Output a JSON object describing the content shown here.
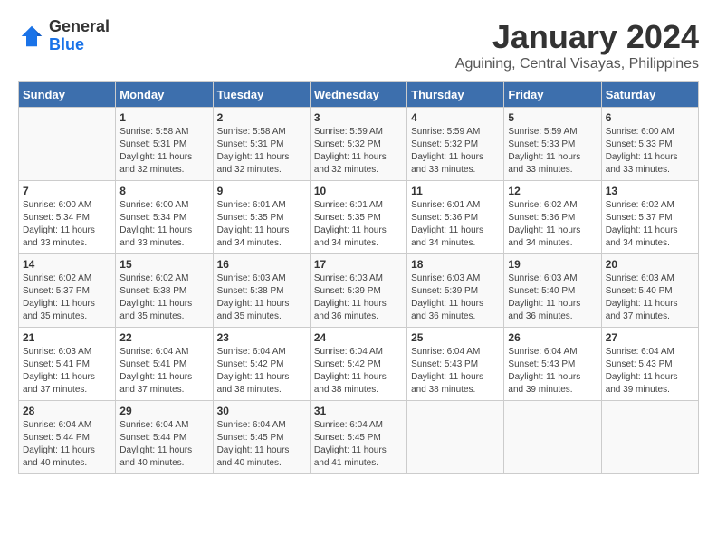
{
  "header": {
    "logo_line1": "General",
    "logo_line2": "Blue",
    "month": "January 2024",
    "location": "Aguining, Central Visayas, Philippines"
  },
  "days_of_week": [
    "Sunday",
    "Monday",
    "Tuesday",
    "Wednesday",
    "Thursday",
    "Friday",
    "Saturday"
  ],
  "weeks": [
    [
      {
        "day": "",
        "detail": ""
      },
      {
        "day": "1",
        "detail": "Sunrise: 5:58 AM\nSunset: 5:31 PM\nDaylight: 11 hours\nand 32 minutes."
      },
      {
        "day": "2",
        "detail": "Sunrise: 5:58 AM\nSunset: 5:31 PM\nDaylight: 11 hours\nand 32 minutes."
      },
      {
        "day": "3",
        "detail": "Sunrise: 5:59 AM\nSunset: 5:32 PM\nDaylight: 11 hours\nand 32 minutes."
      },
      {
        "day": "4",
        "detail": "Sunrise: 5:59 AM\nSunset: 5:32 PM\nDaylight: 11 hours\nand 33 minutes."
      },
      {
        "day": "5",
        "detail": "Sunrise: 5:59 AM\nSunset: 5:33 PM\nDaylight: 11 hours\nand 33 minutes."
      },
      {
        "day": "6",
        "detail": "Sunrise: 6:00 AM\nSunset: 5:33 PM\nDaylight: 11 hours\nand 33 minutes."
      }
    ],
    [
      {
        "day": "7",
        "detail": "Sunrise: 6:00 AM\nSunset: 5:34 PM\nDaylight: 11 hours\nand 33 minutes."
      },
      {
        "day": "8",
        "detail": "Sunrise: 6:00 AM\nSunset: 5:34 PM\nDaylight: 11 hours\nand 33 minutes."
      },
      {
        "day": "9",
        "detail": "Sunrise: 6:01 AM\nSunset: 5:35 PM\nDaylight: 11 hours\nand 34 minutes."
      },
      {
        "day": "10",
        "detail": "Sunrise: 6:01 AM\nSunset: 5:35 PM\nDaylight: 11 hours\nand 34 minutes."
      },
      {
        "day": "11",
        "detail": "Sunrise: 6:01 AM\nSunset: 5:36 PM\nDaylight: 11 hours\nand 34 minutes."
      },
      {
        "day": "12",
        "detail": "Sunrise: 6:02 AM\nSunset: 5:36 PM\nDaylight: 11 hours\nand 34 minutes."
      },
      {
        "day": "13",
        "detail": "Sunrise: 6:02 AM\nSunset: 5:37 PM\nDaylight: 11 hours\nand 34 minutes."
      }
    ],
    [
      {
        "day": "14",
        "detail": "Sunrise: 6:02 AM\nSunset: 5:37 PM\nDaylight: 11 hours\nand 35 minutes."
      },
      {
        "day": "15",
        "detail": "Sunrise: 6:02 AM\nSunset: 5:38 PM\nDaylight: 11 hours\nand 35 minutes."
      },
      {
        "day": "16",
        "detail": "Sunrise: 6:03 AM\nSunset: 5:38 PM\nDaylight: 11 hours\nand 35 minutes."
      },
      {
        "day": "17",
        "detail": "Sunrise: 6:03 AM\nSunset: 5:39 PM\nDaylight: 11 hours\nand 36 minutes."
      },
      {
        "day": "18",
        "detail": "Sunrise: 6:03 AM\nSunset: 5:39 PM\nDaylight: 11 hours\nand 36 minutes."
      },
      {
        "day": "19",
        "detail": "Sunrise: 6:03 AM\nSunset: 5:40 PM\nDaylight: 11 hours\nand 36 minutes."
      },
      {
        "day": "20",
        "detail": "Sunrise: 6:03 AM\nSunset: 5:40 PM\nDaylight: 11 hours\nand 37 minutes."
      }
    ],
    [
      {
        "day": "21",
        "detail": "Sunrise: 6:03 AM\nSunset: 5:41 PM\nDaylight: 11 hours\nand 37 minutes."
      },
      {
        "day": "22",
        "detail": "Sunrise: 6:04 AM\nSunset: 5:41 PM\nDaylight: 11 hours\nand 37 minutes."
      },
      {
        "day": "23",
        "detail": "Sunrise: 6:04 AM\nSunset: 5:42 PM\nDaylight: 11 hours\nand 38 minutes."
      },
      {
        "day": "24",
        "detail": "Sunrise: 6:04 AM\nSunset: 5:42 PM\nDaylight: 11 hours\nand 38 minutes."
      },
      {
        "day": "25",
        "detail": "Sunrise: 6:04 AM\nSunset: 5:43 PM\nDaylight: 11 hours\nand 38 minutes."
      },
      {
        "day": "26",
        "detail": "Sunrise: 6:04 AM\nSunset: 5:43 PM\nDaylight: 11 hours\nand 39 minutes."
      },
      {
        "day": "27",
        "detail": "Sunrise: 6:04 AM\nSunset: 5:43 PM\nDaylight: 11 hours\nand 39 minutes."
      }
    ],
    [
      {
        "day": "28",
        "detail": "Sunrise: 6:04 AM\nSunset: 5:44 PM\nDaylight: 11 hours\nand 40 minutes."
      },
      {
        "day": "29",
        "detail": "Sunrise: 6:04 AM\nSunset: 5:44 PM\nDaylight: 11 hours\nand 40 minutes."
      },
      {
        "day": "30",
        "detail": "Sunrise: 6:04 AM\nSunset: 5:45 PM\nDaylight: 11 hours\nand 40 minutes."
      },
      {
        "day": "31",
        "detail": "Sunrise: 6:04 AM\nSunset: 5:45 PM\nDaylight: 11 hours\nand 41 minutes."
      },
      {
        "day": "",
        "detail": ""
      },
      {
        "day": "",
        "detail": ""
      },
      {
        "day": "",
        "detail": ""
      }
    ]
  ]
}
